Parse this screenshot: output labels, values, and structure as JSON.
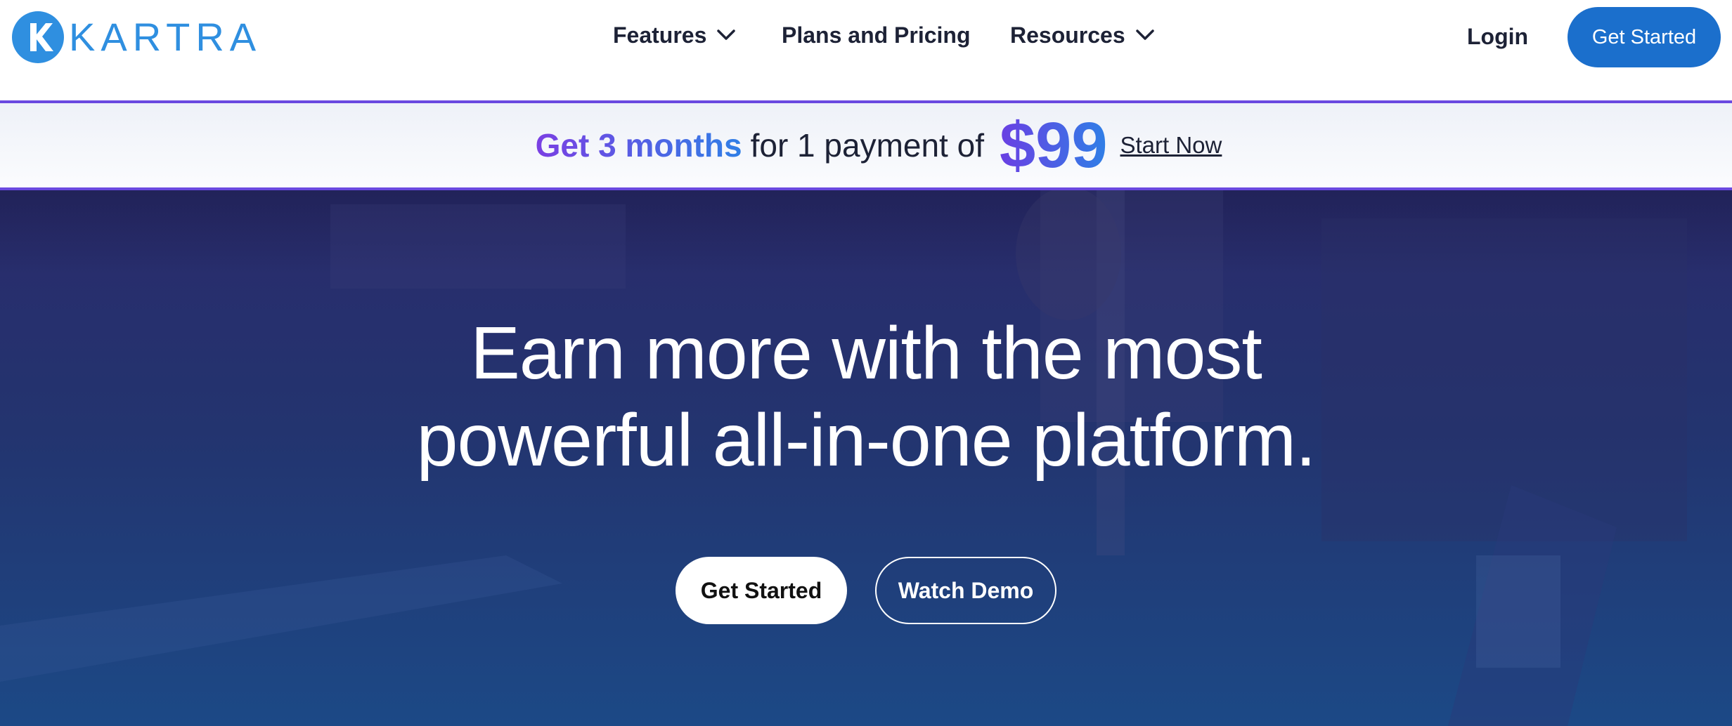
{
  "header": {
    "logo_text": "KARTRA",
    "nav": {
      "features": "Features",
      "pricing": "Plans and Pricing",
      "resources": "Resources"
    },
    "login": "Login",
    "cta": "Get Started"
  },
  "promo": {
    "lead": "Get 3 months",
    "middle": "for 1 payment of",
    "price": "$99",
    "link": "Start Now"
  },
  "hero": {
    "title_line1": "Earn more with the most",
    "title_line2": "powerful all-in-one platform.",
    "primary_button": "Get Started",
    "secondary_button": "Watch Demo"
  },
  "colors": {
    "brand_blue": "#2f8fe0",
    "cta_blue": "#1b6fcc",
    "promo_purple": "#6a49e0",
    "hero_navy": "#23346f"
  }
}
